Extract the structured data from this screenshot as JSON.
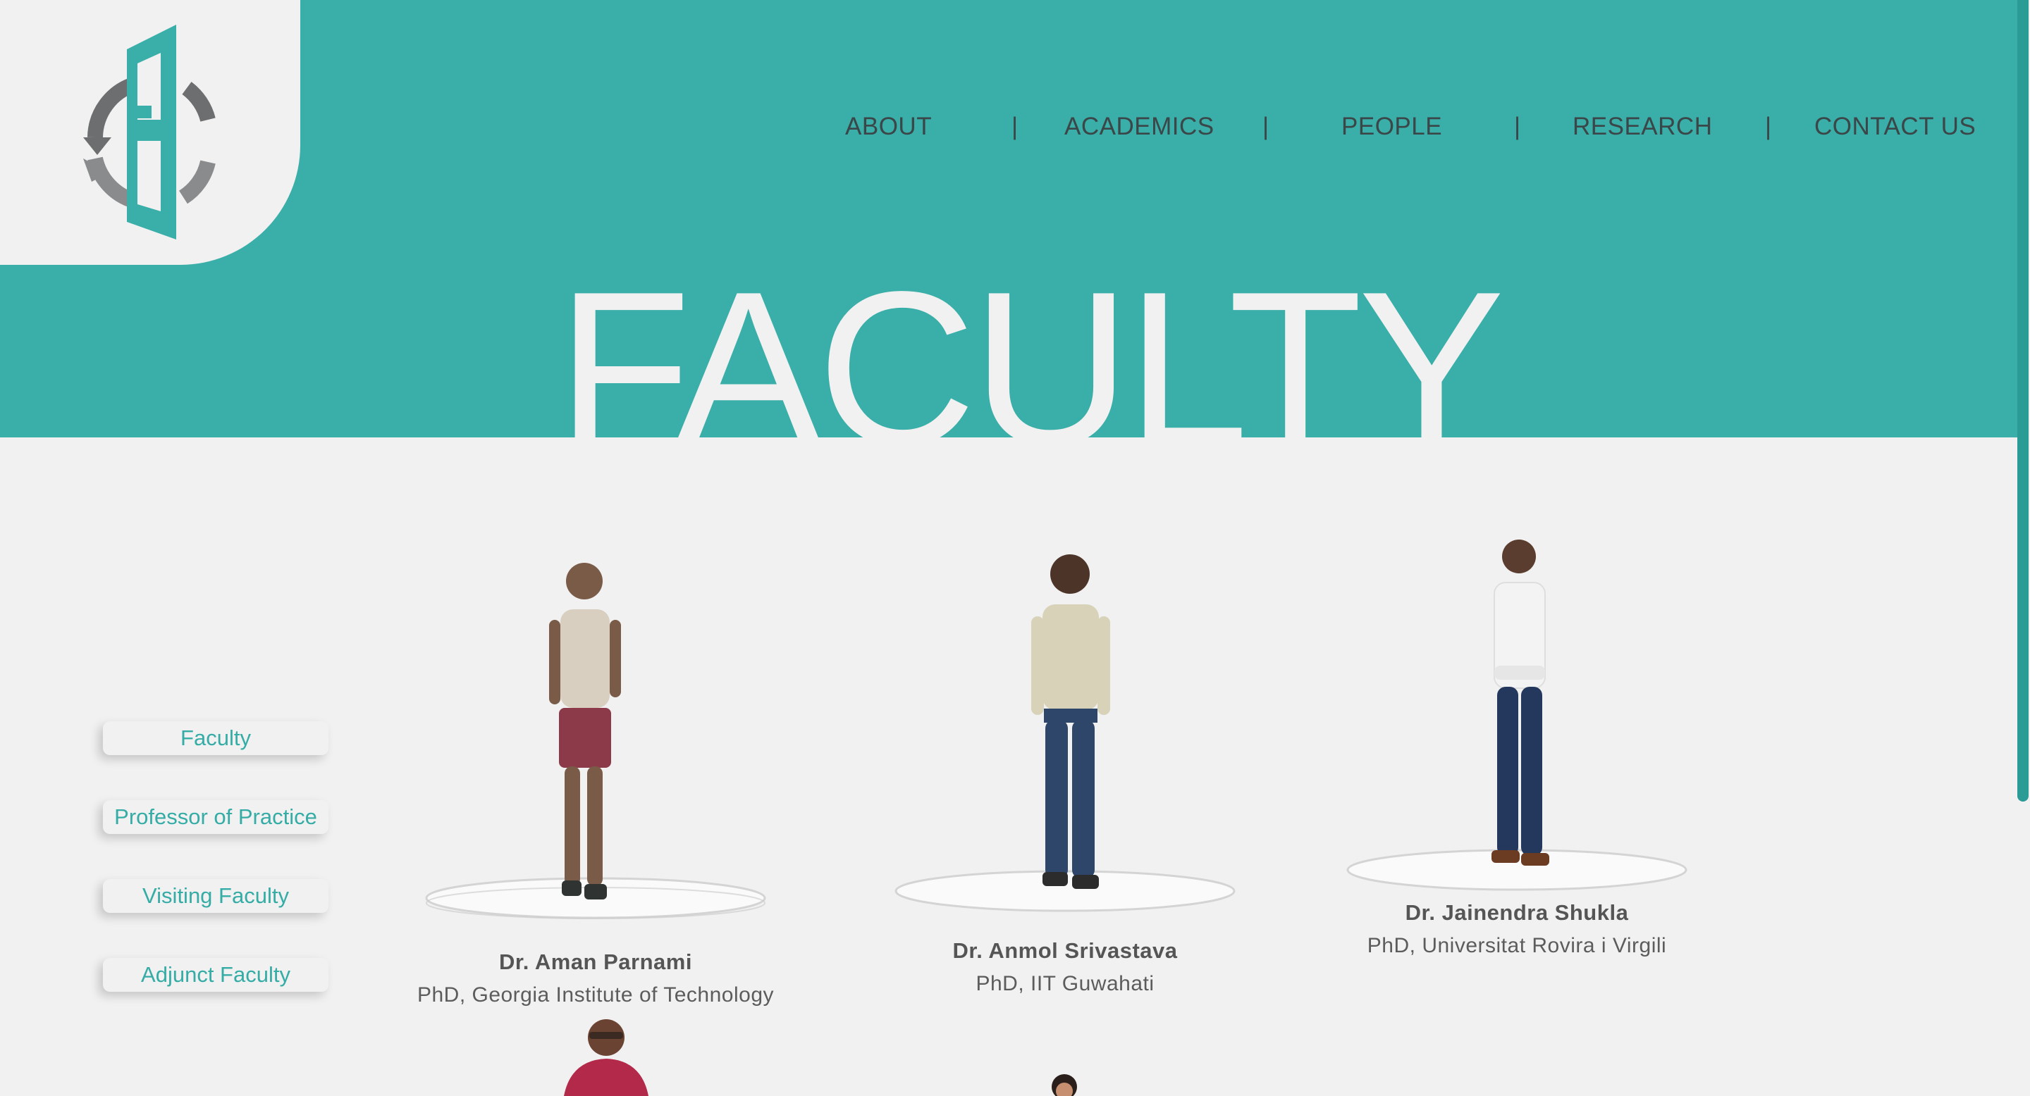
{
  "site": {
    "logo_name": "college-logo",
    "accent": "#3aaea8",
    "background": "#f1f1f1"
  },
  "nav": {
    "items": [
      "ABOUT",
      "ACADEMICS",
      "PEOPLE",
      "RESEARCH",
      "CONTACT US"
    ],
    "separator": "|"
  },
  "hero": {
    "title": "FACULTY"
  },
  "sidebar": {
    "items": [
      "Faculty",
      "Professor of Practice",
      "Visiting Faculty",
      "Adjunct Faculty"
    ]
  },
  "faculty": [
    {
      "name": "Dr. Aman Parnami",
      "degree": "PhD, Georgia Institute of Technology",
      "shirt": "#d9cfc0",
      "pants": "#8c3a4a"
    },
    {
      "name": "Dr. Anmol Srivastava",
      "degree": "PhD, IIT Guwahati",
      "shirt": "#d8d2b8",
      "pants": "#2f466b"
    },
    {
      "name": "Dr. Jainendra Shukla",
      "degree": "PhD, Universitat Rovira i Virgili",
      "shirt": "#f3f3f3",
      "pants": "#23385c"
    }
  ]
}
